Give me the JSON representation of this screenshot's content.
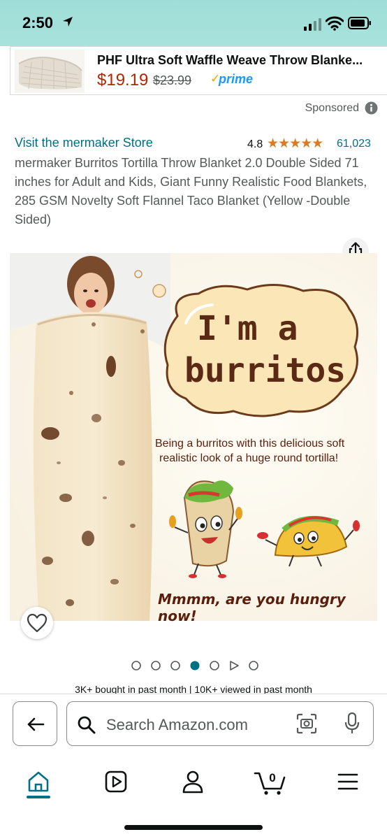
{
  "status_bar": {
    "time": "2:50",
    "icons": [
      "location-arrow-icon",
      "cellular-signal-icon",
      "wifi-icon",
      "battery-icon"
    ]
  },
  "ad": {
    "title": "PHF Ultra Soft Waffle Weave Throw Blanke...",
    "price": "$19.19",
    "old_price": "$23.99",
    "prime_check": "✓",
    "prime_label": "prime",
    "sponsored_label": "Sponsored"
  },
  "product": {
    "store_link": "Visit the mermaker Store",
    "rating": "4.8",
    "stars": "★★★★★",
    "rating_fraction": 0.96,
    "rating_count": "61,023",
    "title": "mermaker Burritos Tortilla Throw Blanket 2.0 Double Sided 71 inches for Adult and Kids, Giant Funny Realistic Food Blankets, 285 GSM Novelty Soft Flannel Taco Blanket (Yellow -Double Sided)"
  },
  "image": {
    "bubble_line_1": "I'm a",
    "bubble_line_2": "burritos",
    "caption_line_1": "Being a burritos with this delicious soft",
    "caption_line_2": "realistic look of a huge round tortilla!",
    "hungry": "Mmmm, are you hungry now!"
  },
  "carousel": {
    "count": 7,
    "active_index": 3,
    "video_index": 5
  },
  "social_proof": "3K+ bought in past month  |  10K+ viewed in past month",
  "search": {
    "placeholder": "Search Amazon.com"
  },
  "bottom_nav": {
    "items": [
      "home-icon",
      "video-icon",
      "account-icon",
      "cart-icon",
      "menu-icon"
    ],
    "cart_count": "0",
    "active": "home"
  },
  "colors": {
    "accent": "#007185",
    "price": "#b12704",
    "stars": "#de7921",
    "prime": "#1a98ff",
    "status_bar": "#a3e0da"
  }
}
